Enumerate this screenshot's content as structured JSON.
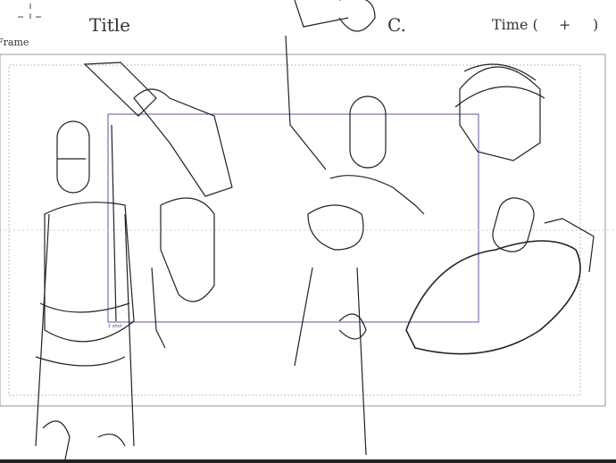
{
  "header": {
    "title_label": "Title",
    "cut_label": "C.",
    "time_label": "Time (",
    "time_plus": "+",
    "time_close": ")",
    "frame_label": "Frame"
  },
  "frame": {
    "safe_area_label": "1 shot"
  },
  "colors": {
    "safe_area": "#5a55b0",
    "frame_border": "#999999",
    "sketch": "#222222"
  }
}
